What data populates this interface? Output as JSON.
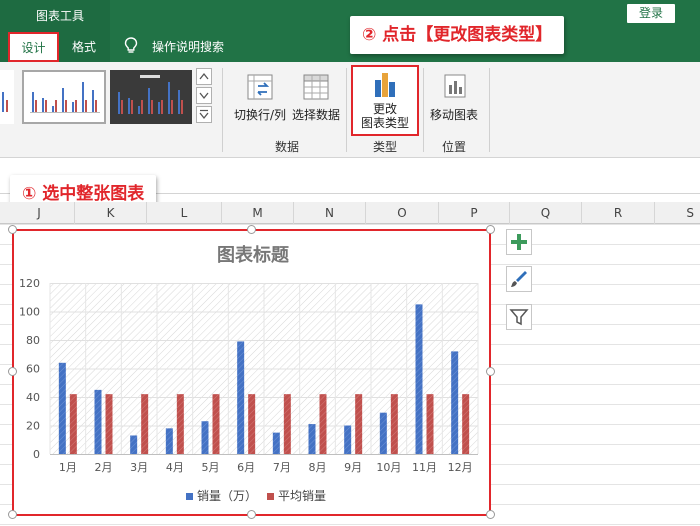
{
  "window": {
    "context_tab_group": "图表工具",
    "login_label": "登录"
  },
  "tabs": [
    {
      "label": "设计",
      "active": true
    },
    {
      "label": "格式",
      "active": false
    }
  ],
  "search": {
    "label": "操作说明搜索"
  },
  "ribbon": {
    "buttons": {
      "switch_row_col": "切换行/列",
      "select_data": "选择数据",
      "change_type_line1": "更改",
      "change_type_line2": "图表类型",
      "move_chart": "移动图表"
    },
    "groups": {
      "data": "数据",
      "type": "类型",
      "location": "位置"
    }
  },
  "callouts": {
    "step1": "① 选中整张图表",
    "step2": "② 点击【更改图表类型】"
  },
  "columns": [
    "J",
    "K",
    "L",
    "M",
    "N",
    "O",
    "P",
    "Q",
    "R",
    "S"
  ],
  "colors": {
    "excel_green": "#217346",
    "highlight_red": "#e1262b",
    "series_blue": "#4472c4",
    "series_red": "#c0504d"
  },
  "chart_data": {
    "type": "bar",
    "title": "图表标题",
    "categories": [
      "1月",
      "2月",
      "3月",
      "4月",
      "5月",
      "6月",
      "7月",
      "8月",
      "9月",
      "10月",
      "11月",
      "12月"
    ],
    "series": [
      {
        "name": "销量（万）",
        "color": "#4472c4",
        "values": [
          64,
          45,
          13,
          18,
          23,
          79,
          15,
          21,
          20,
          29,
          105,
          72
        ]
      },
      {
        "name": "平均销量",
        "color": "#c0504d",
        "values": [
          42,
          42,
          42,
          42,
          42,
          42,
          42,
          42,
          42,
          42,
          42,
          42
        ]
      }
    ],
    "ylim": [
      0,
      120
    ],
    "yticks": [
      0,
      20,
      40,
      60,
      80,
      100,
      120
    ],
    "grid": true,
    "legend": "bottom"
  }
}
